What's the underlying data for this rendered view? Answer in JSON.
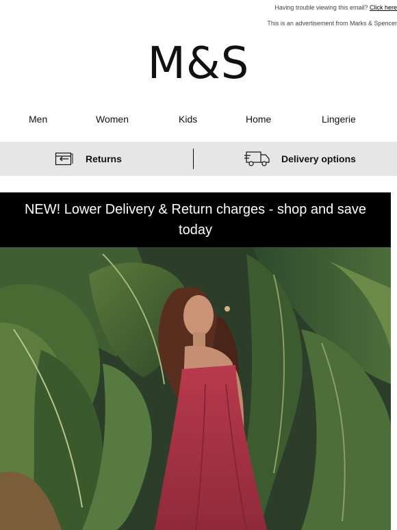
{
  "preheader": {
    "trouble_text": "Having trouble viewing this email?",
    "click_here": "Click here",
    "ad_text": "This is an advertisement from Marks & Spencer"
  },
  "brand": {
    "logo_text": "M&S"
  },
  "nav": {
    "items": [
      {
        "label": "Men"
      },
      {
        "label": "Women"
      },
      {
        "label": "Kids"
      },
      {
        "label": "Home"
      },
      {
        "label": "Lingerie"
      }
    ]
  },
  "utility_bar": {
    "returns_label": "Returns",
    "returns_icon": "returns-icon",
    "delivery_label": "Delivery options",
    "delivery_icon": "delivery-truck-icon",
    "background": "#e6e6e6"
  },
  "promo_banner": {
    "text": "NEW! Lower Delivery & Return charges - shop and save today",
    "background": "#000000",
    "color": "#ffffff"
  },
  "hero": {
    "dress_color": "#b33a4a",
    "foliage_color": "#3f5f38"
  }
}
